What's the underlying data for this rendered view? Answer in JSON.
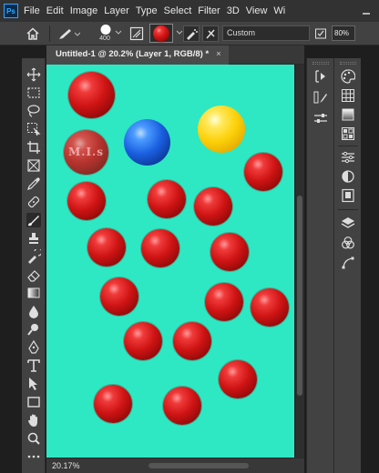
{
  "app": {
    "logo": "Ps",
    "menu": [
      "File",
      "Edit",
      "Image",
      "Layer",
      "Type",
      "Select",
      "Filter",
      "3D",
      "View",
      "Wi"
    ]
  },
  "options_bar": {
    "brush_size": "400",
    "mode": "Custom",
    "zoom_field": "80%"
  },
  "document": {
    "tab_title": "Untitled-1 @ 20.2% (Layer 1, RGB/8) *",
    "tab_close": "×",
    "canvas_color": "#2de8c3",
    "watermark_text": "M.I.s"
  },
  "balls": [
    {
      "color": "red",
      "shade": "#cf1414"
    },
    {
      "color": "blue",
      "shade": "#1a5fe0"
    },
    {
      "color": "yellow",
      "shade": "#fcd10a"
    }
  ],
  "status": {
    "zoom": "20.17%"
  },
  "toolbox_icons": [
    "move-icon",
    "marquee-icon",
    "lasso-icon",
    "object-select-icon",
    "crop-icon",
    "frame-icon",
    "eyedropper-icon",
    "healing-brush-icon",
    "brush-icon",
    "clone-stamp-icon",
    "history-brush-icon",
    "eraser-icon",
    "gradient-icon",
    "blur-icon",
    "dodge-icon",
    "pen-icon",
    "type-icon",
    "path-select-icon",
    "rectangle-icon",
    "hand-icon",
    "zoom-icon",
    "more-icon"
  ],
  "panel_icons": [
    "history-icon",
    "brush-settings-icon",
    "adjust-icon",
    "color-icon",
    "swatches-icon",
    "gradients-icon",
    "patterns-icon",
    "properties-icon",
    "adjustments-icon",
    "libraries-icon",
    "layers-icon",
    "channels-icon",
    "paths-icon"
  ]
}
